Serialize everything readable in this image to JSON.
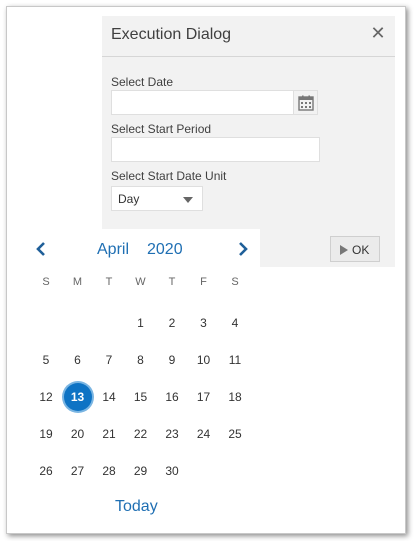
{
  "dialog": {
    "title": "Execution Dialog",
    "close_icon": "close-icon",
    "select_date_label": "Select Date",
    "select_date_value": "",
    "calendar_icon": "calendar-icon",
    "start_period_label": "Select Start Period",
    "start_period_value": "",
    "start_date_unit_label": "Select Start Date Unit",
    "start_date_unit_value": "Day",
    "ok_label": "OK",
    "ok_icon": "play-icon"
  },
  "calendar": {
    "month": "April",
    "year": "2020",
    "prev_icon": "chevron-left-icon",
    "next_icon": "chevron-right-icon",
    "weekdays": [
      "S",
      "M",
      "T",
      "W",
      "T",
      "F",
      "S"
    ],
    "days": [
      "1",
      "2",
      "3",
      "4",
      "5",
      "6",
      "7",
      "8",
      "9",
      "10",
      "11",
      "12",
      "13",
      "14",
      "15",
      "16",
      "17",
      "18",
      "19",
      "20",
      "21",
      "22",
      "23",
      "24",
      "25",
      "26",
      "27",
      "28",
      "29",
      "30"
    ],
    "selected_day": "13",
    "today_label": "Today",
    "accent_color": "#0e73c4",
    "link_color": "#1f6fb3"
  }
}
